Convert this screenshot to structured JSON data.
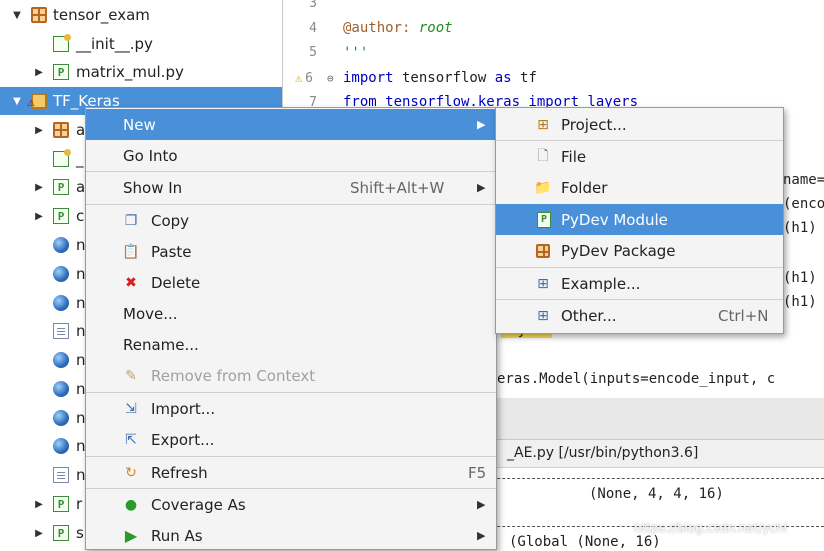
{
  "tree": {
    "items": [
      {
        "label": "tensor_exam",
        "icon": "package-icon"
      },
      {
        "label": "__init__.py",
        "icon": "init-file-icon"
      },
      {
        "label": "matrix_mul.py",
        "icon": "python-file-icon"
      },
      {
        "label": "TF_Keras",
        "icon": "project-folder-icon"
      },
      {
        "label": "a",
        "icon": "package-icon"
      },
      {
        "label": "_",
        "icon": "init-file-icon"
      },
      {
        "label": "a",
        "icon": "python-file-icon"
      },
      {
        "label": "c",
        "icon": "python-file-icon"
      },
      {
        "label": "n",
        "icon": "globe-icon"
      },
      {
        "label": "n",
        "icon": "globe-icon"
      },
      {
        "label": "n",
        "icon": "globe-icon"
      },
      {
        "label": "n",
        "icon": "doc-icon"
      },
      {
        "label": "n",
        "icon": "globe-icon"
      },
      {
        "label": "n",
        "icon": "globe-icon"
      },
      {
        "label": "n",
        "icon": "globe-icon"
      },
      {
        "label": "n",
        "icon": "globe-icon"
      },
      {
        "label": "n",
        "icon": "doc-icon"
      },
      {
        "label": "r",
        "icon": "python-file-icon"
      },
      {
        "label": "s",
        "icon": "python-file-icon"
      }
    ]
  },
  "editor": {
    "line_numbers": [
      "3",
      "4",
      "5",
      "6",
      "7"
    ],
    "line4_decorator": "@author:",
    "line4_value": " root",
    "line5": "'''",
    "line6_import": "import",
    "line6_rest": " tensorflow ",
    "line6_as": "as",
    "line6_end": " tf",
    "line7": "from tensorflow.keras import layers",
    "frag_name": "name=",
    "frag_enco": "(enco",
    "frag_h1_a": "(h1)",
    "frag_h1_b": "(h1)",
    "frag_h1_c": "(h1)",
    "frag_layers": "layers",
    "frag_model": "eras.Model(inputs=encode_input, c"
  },
  "console": {
    "header": "_AE.py [/usr/bin/python3.6]",
    "line1": "(None, 4, 4, 16)",
    "line2": "(Global (None, 16)"
  },
  "context_menu": {
    "items": [
      {
        "label": "New",
        "submenu": true
      },
      {
        "label": "Go Into"
      },
      {
        "label": "Show In",
        "shortcut": "Shift+Alt+W",
        "submenu": true
      },
      {
        "label": "Copy",
        "icon": "copy-icon"
      },
      {
        "label": "Paste",
        "icon": "paste-icon"
      },
      {
        "label": "Delete",
        "icon": "delete-icon"
      },
      {
        "label": "Move..."
      },
      {
        "label": "Rename..."
      },
      {
        "label": "Remove from Context",
        "icon": "remove-context-icon",
        "disabled": true
      },
      {
        "label": "Import...",
        "icon": "import-icon"
      },
      {
        "label": "Export...",
        "icon": "export-icon"
      },
      {
        "label": "Refresh",
        "icon": "refresh-icon",
        "shortcut": "F5"
      },
      {
        "label": "Coverage As",
        "icon": "coverage-icon",
        "submenu": true
      },
      {
        "label": "Run As",
        "icon": "run-icon",
        "submenu": true
      }
    ]
  },
  "new_submenu": {
    "items": [
      {
        "label": "Project...",
        "icon": "new-project-icon"
      },
      {
        "label": "File",
        "icon": "new-file-icon"
      },
      {
        "label": "Folder",
        "icon": "new-folder-icon"
      },
      {
        "label": "PyDev Module",
        "icon": "pydev-module-icon"
      },
      {
        "label": "PyDev Package",
        "icon": "pydev-package-icon"
      },
      {
        "label": "Example...",
        "icon": "example-icon"
      },
      {
        "label": "Other...",
        "icon": "other-icon",
        "shortcut": "Ctrl+N"
      }
    ]
  },
  "watermark": "https://blog.csdn.net/ychl",
  "colors": {
    "selection": "#4a90d9",
    "menu_bg": "#f4f4f4",
    "keyword": "#0000c0",
    "docstring": "#208c20"
  }
}
